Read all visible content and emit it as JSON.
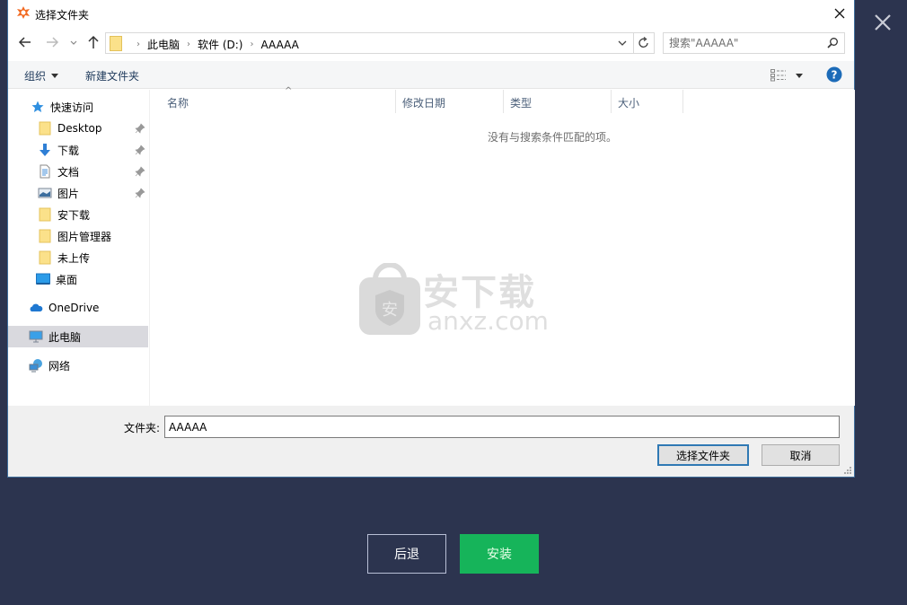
{
  "background": {
    "close_icon": "close-icon",
    "buttons": {
      "back_label": "后退",
      "install_label": "安装"
    },
    "colors": {
      "background": "#2c344f",
      "install": "#16b45a"
    }
  },
  "dialog": {
    "title": "选择文件夹",
    "app_icon": "avast-logo-icon",
    "nav": {
      "back_icon": "arrow-left-icon",
      "forward_icon": "arrow-right-icon",
      "recent_icon": "chevron-down-icon",
      "up_icon": "arrow-up-icon"
    },
    "address": {
      "breadcrumbs": [
        "此电脑",
        "软件 (D:)",
        "AAAAA"
      ],
      "separator": "›"
    },
    "search": {
      "placeholder": "搜索\"AAAAA\""
    },
    "toolbar": {
      "organize_label": "组织",
      "new_folder_label": "新建文件夹",
      "view_icon": "details-view-icon",
      "help_icon": "help-icon"
    },
    "sidebar": {
      "quick_access": {
        "label": "快速访问",
        "icon": "star-icon"
      },
      "items": [
        {
          "label": "Desktop",
          "icon": "folder-icon",
          "pinned": true
        },
        {
          "label": "下载",
          "icon": "download-arrow-icon",
          "pinned": true
        },
        {
          "label": "文档",
          "icon": "document-icon",
          "pinned": true
        },
        {
          "label": "图片",
          "icon": "picture-icon",
          "pinned": true
        },
        {
          "label": "安下载",
          "icon": "folder-icon",
          "pinned": false
        },
        {
          "label": "图片管理器",
          "icon": "folder-icon",
          "pinned": false
        },
        {
          "label": "未上传",
          "icon": "folder-icon",
          "pinned": false
        },
        {
          "label": "桌面",
          "icon": "desktop-icon",
          "pinned": false
        }
      ],
      "onedrive": {
        "label": "OneDrive",
        "icon": "cloud-icon"
      },
      "this_pc": {
        "label": "此电脑",
        "icon": "monitor-icon",
        "selected": true
      },
      "network": {
        "label": "网络",
        "icon": "network-icon"
      }
    },
    "columns": [
      "名称",
      "修改日期",
      "类型",
      "大小"
    ],
    "empty_message": "没有与搜索条件匹配的项。",
    "watermark": {
      "cn": "安下载",
      "en": "anxz.com"
    },
    "footer": {
      "folder_label": "文件夹:",
      "folder_value": "AAAAA",
      "select_label": "选择文件夹",
      "cancel_label": "取消"
    }
  }
}
